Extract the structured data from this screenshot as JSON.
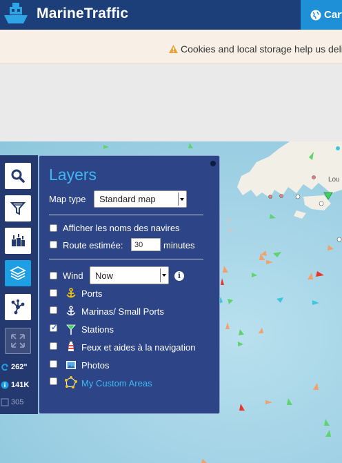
{
  "header": {
    "brand": "MarineTraffic",
    "cart_label": "Cart"
  },
  "cookie_bar": {
    "text": "Cookies and local storage help us deliv"
  },
  "toolbar": {
    "buttons": [
      {
        "name": "search",
        "icon": "search-icon"
      },
      {
        "name": "filter",
        "icon": "filter-icon"
      },
      {
        "name": "density",
        "icon": "vessels-icon"
      },
      {
        "name": "layers",
        "icon": "layers-icon",
        "active": true
      },
      {
        "name": "network",
        "icon": "network-icon"
      },
      {
        "name": "fullscreen",
        "icon": "expand-icon",
        "disabled": true
      }
    ],
    "stats": {
      "refresh": "262\"",
      "count": "141K",
      "selected": "305"
    }
  },
  "layers_panel": {
    "title": "Layers",
    "map_type_label": "Map type",
    "map_type_value": "Standard map",
    "show_names_label": "Afficher les noms des navires",
    "route_label": "Route estimée:",
    "route_value": "30",
    "route_unit": "minutes",
    "wind_label": "Wind",
    "wind_value": "Now",
    "info_glyph": "i",
    "layers": [
      {
        "label": "Ports",
        "checked": false,
        "icon": "anchor-yellow-icon"
      },
      {
        "label": "Marinas/ Small Ports",
        "checked": false,
        "icon": "anchor-white-icon"
      },
      {
        "label": "Stations",
        "checked": true,
        "icon": "station-icon"
      },
      {
        "label": "Feux et aides à la navigation",
        "checked": false,
        "icon": "lighthouse-icon"
      },
      {
        "label": "Photos",
        "checked": false,
        "icon": "photo-icon"
      },
      {
        "label": "My Custom Areas",
        "checked": false,
        "icon": "polygon-icon",
        "link": true
      }
    ]
  },
  "colors": {
    "header_bg": "#1c3f7a",
    "accent": "#1e90d8",
    "panel_bg": "#2d4587",
    "title": "#3fb7f3"
  }
}
